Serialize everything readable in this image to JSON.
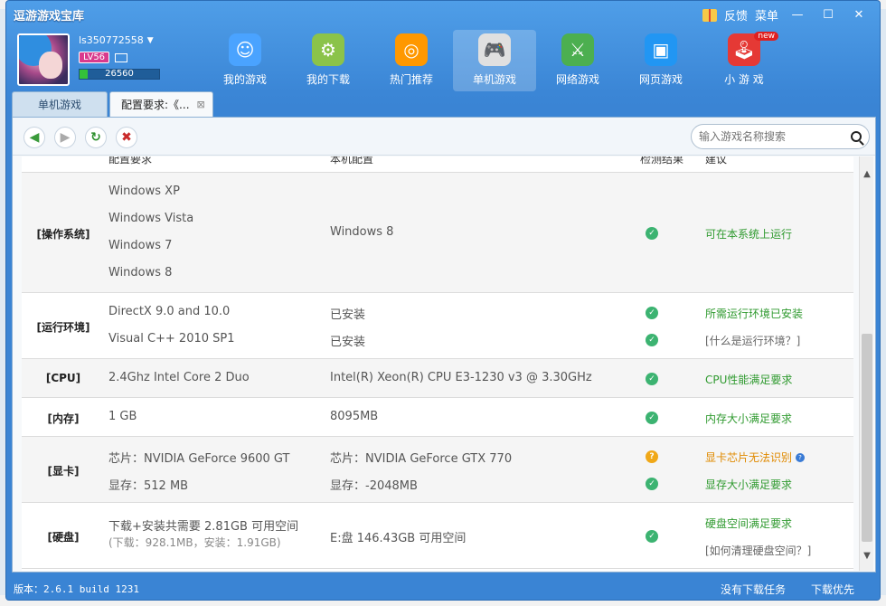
{
  "app": {
    "title": "逗游游戏宝库",
    "actions": {
      "feedback": "反馈",
      "menu": "菜单"
    }
  },
  "user": {
    "name": "ls350772558",
    "level": "LV56",
    "xp": "26560",
    "xp_fraction": 0.1
  },
  "nav": [
    {
      "label": "我的游戏",
      "icon": "person-icon",
      "color": "#4aa3ff"
    },
    {
      "label": "我的下载",
      "icon": "download-gear-icon",
      "color": "#8bc34a"
    },
    {
      "label": "热门推荐",
      "icon": "disc-plus-icon",
      "color": "#ff9800"
    },
    {
      "label": "单机游戏",
      "icon": "gamepad-icon",
      "color": "#e0e0e0"
    },
    {
      "label": "网络游戏",
      "icon": "sword-globe-icon",
      "color": "#4caf50"
    },
    {
      "label": "网页游戏",
      "icon": "web-page-icon",
      "color": "#2196f3"
    },
    {
      "label": "小 游 戏",
      "icon": "joystick-icon",
      "color": "#e53935",
      "badge": "new"
    }
  ],
  "tabs": [
    {
      "label": "单机游戏"
    },
    {
      "label": "配置要求:《..."
    }
  ],
  "search": {
    "placeholder": "输入游戏名称搜索"
  },
  "table": {
    "headers": [
      "配置要求",
      "本机配置",
      "检测结果",
      "建议"
    ],
    "rows": [
      {
        "category": "[操作系统]",
        "req": [
          "Windows XP",
          "Windows Vista",
          "Windows 7",
          "Windows 8"
        ],
        "mine": [
          "Windows 8"
        ],
        "results": [
          "ok"
        ],
        "sugg": [
          "可在本系统上运行"
        ]
      },
      {
        "category": "[运行环境]",
        "req": [
          "DirectX 9.0 and 10.0",
          "Visual C++ 2010 SP1"
        ],
        "mine": [
          "已安装",
          "已安装"
        ],
        "results": [
          "ok",
          "ok"
        ],
        "sugg": [
          "所需运行环境已安装",
          "[什么是运行环境？]"
        ]
      },
      {
        "category": "[CPU]",
        "req": [
          "2.4Ghz Intel Core 2 Duo"
        ],
        "mine": [
          "Intel(R) Xeon(R) CPU E3-1230 v3 @ 3.30GHz"
        ],
        "results": [
          "ok"
        ],
        "sugg": [
          "CPU性能满足要求"
        ]
      },
      {
        "category": "[内存]",
        "req": [
          "1 GB"
        ],
        "mine": [
          "8095MB"
        ],
        "results": [
          "ok"
        ],
        "sugg": [
          "内存大小满足要求"
        ]
      },
      {
        "category": "[显卡]",
        "req": [
          "芯片：NVIDIA GeForce 9600 GT",
          "显存：512 MB"
        ],
        "mine": [
          "芯片：NVIDIA GeForce GTX 770",
          "显存：-2048MB"
        ],
        "results": [
          "warn",
          "ok"
        ],
        "sugg": [
          "显卡芯片无法识别",
          "显存大小满足要求"
        ]
      },
      {
        "category": "[硬盘]",
        "req": [
          "下载+安装共需要  2.81GB 可用空间",
          "(下载：928.1MB，安装：1.91GB)"
        ],
        "mine": [
          "E:盘  146.43GB 可用空间"
        ],
        "results": [
          "ok"
        ],
        "sugg": [
          "硬盘空间满足要求",
          "[如何清理硬盘空间？]"
        ]
      }
    ]
  },
  "status": {
    "version": "版本：2.6.1 build 1231",
    "no_tasks": "没有下载任务",
    "download_priority": "下载优先"
  },
  "colors": {
    "accent": "#3a84d4",
    "ok": "#3cb371",
    "warn": "#f0a818"
  }
}
